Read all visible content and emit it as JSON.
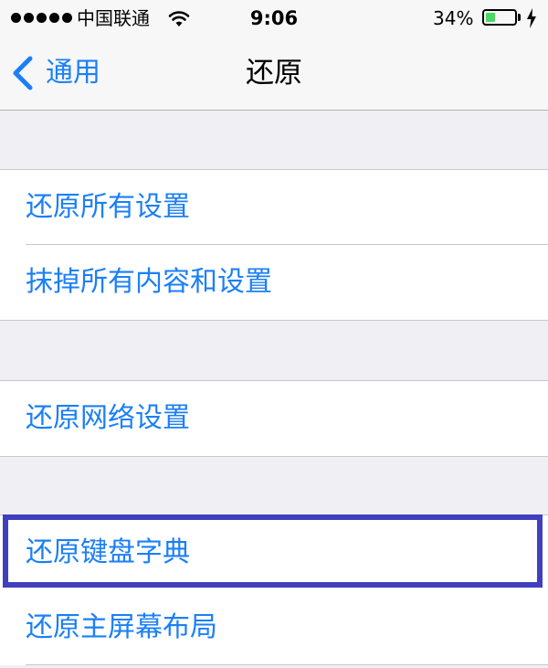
{
  "status_bar": {
    "signal_icon": "signal-dots-icon",
    "carrier": "中国联通",
    "wifi_icon": "wifi-icon",
    "time": "9:06",
    "battery_percent": "34%",
    "battery_level": 0.34,
    "battery_fill_color": "#4cd964",
    "charging_icon": "bolt-icon"
  },
  "nav": {
    "back_icon": "chevron-left-icon",
    "back_label": "通用",
    "title": "还原"
  },
  "colors": {
    "accent": "#1b7ff7",
    "background": "#efeff4",
    "highlight_border": "#3f3fbf"
  },
  "groups": [
    {
      "items": [
        {
          "label": "还原所有设置"
        },
        {
          "label": "抹掉所有内容和设置"
        }
      ]
    },
    {
      "items": [
        {
          "label": "还原网络设置"
        }
      ]
    },
    {
      "items": [
        {
          "label": "还原键盘字典",
          "highlighted": true
        },
        {
          "label": "还原主屏幕布局"
        }
      ]
    }
  ]
}
